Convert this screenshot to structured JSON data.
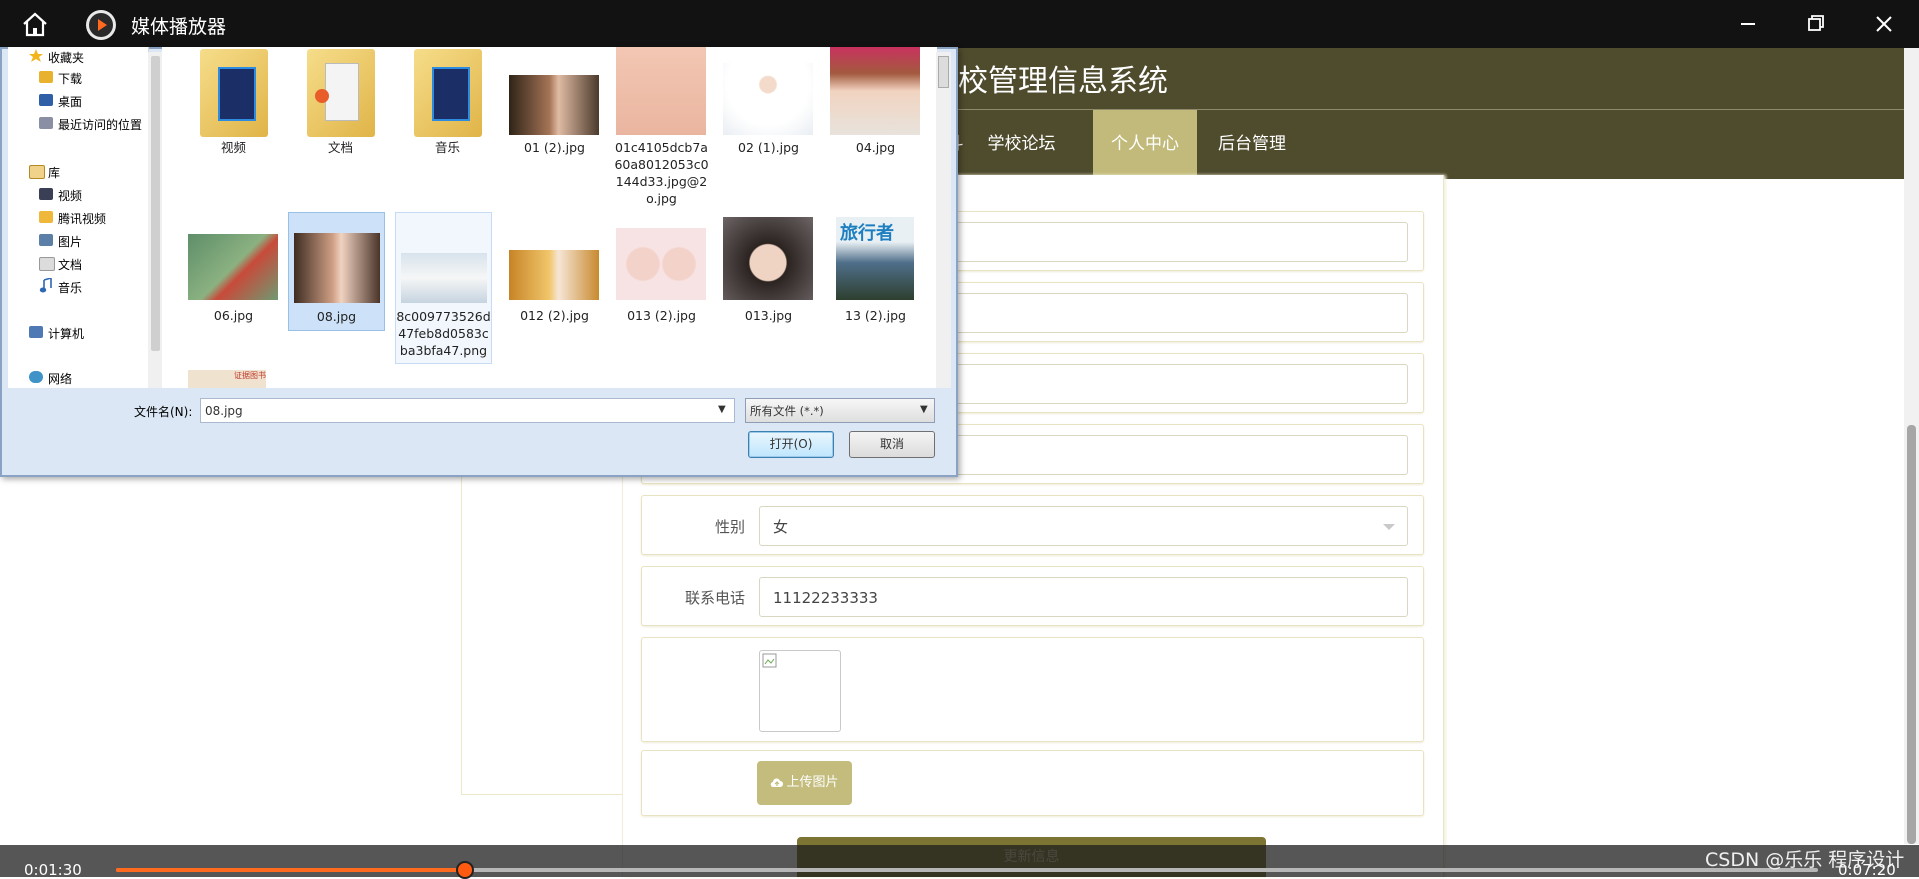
{
  "player": {
    "title": "媒体播放器",
    "time_current": "0:01:30",
    "time_total": "0:07:20",
    "progress_fraction": 0.205,
    "watermark": "CSDN @乐乐 程序设计",
    "colors": {
      "titlebar": "#121212",
      "progress": "#ff6a1e"
    }
  },
  "site": {
    "title": "校管理信息系统",
    "nav": [
      {
        "label": "斗"
      },
      {
        "label": "学校论坛"
      },
      {
        "label": "个人中心",
        "active": true
      },
      {
        "label": "后台管理"
      }
    ],
    "form": {
      "gender_label": "性别",
      "gender_value": "女",
      "phone_label": "联系电话",
      "phone_value": "11122233333",
      "upload_label": "上传图片",
      "update_label": "更新信息"
    },
    "colors": {
      "header": "#4f4b2d",
      "nav_active": "#c2ba7a",
      "button": "#c3bc7c"
    }
  },
  "dialog": {
    "nav_tree": {
      "favorites": "收藏夹",
      "favorites_items": [
        "下载",
        "桌面",
        "最近访问的位置"
      ],
      "library": "库",
      "library_items": [
        "视频",
        "腾讯视频",
        "图片",
        "文档",
        "音乐"
      ],
      "computer": "计算机",
      "network": "网络"
    },
    "files_row1": [
      "视频",
      "文档",
      "音乐",
      "01 (2).jpg",
      "01c4105dcb7a60a8012053c0144d33.jpg@2o.jpg",
      "02 (1).jpg",
      "04.jpg"
    ],
    "files_row2": [
      "06.jpg",
      "08.jpg",
      "8c009773526d47feb8d0583cba3bfa47.png",
      "012 (2).jpg",
      "013 (2).jpg",
      "013.jpg",
      "13 (2).jpg"
    ],
    "row3_partial_label": "证据图书",
    "selected_file": "08.jpg",
    "filename_label": "文件名(N):",
    "filename_value": "08.jpg",
    "filetype_value": "所有文件 (*.*)",
    "open_label": "打开(O)",
    "cancel_label": "取消"
  }
}
